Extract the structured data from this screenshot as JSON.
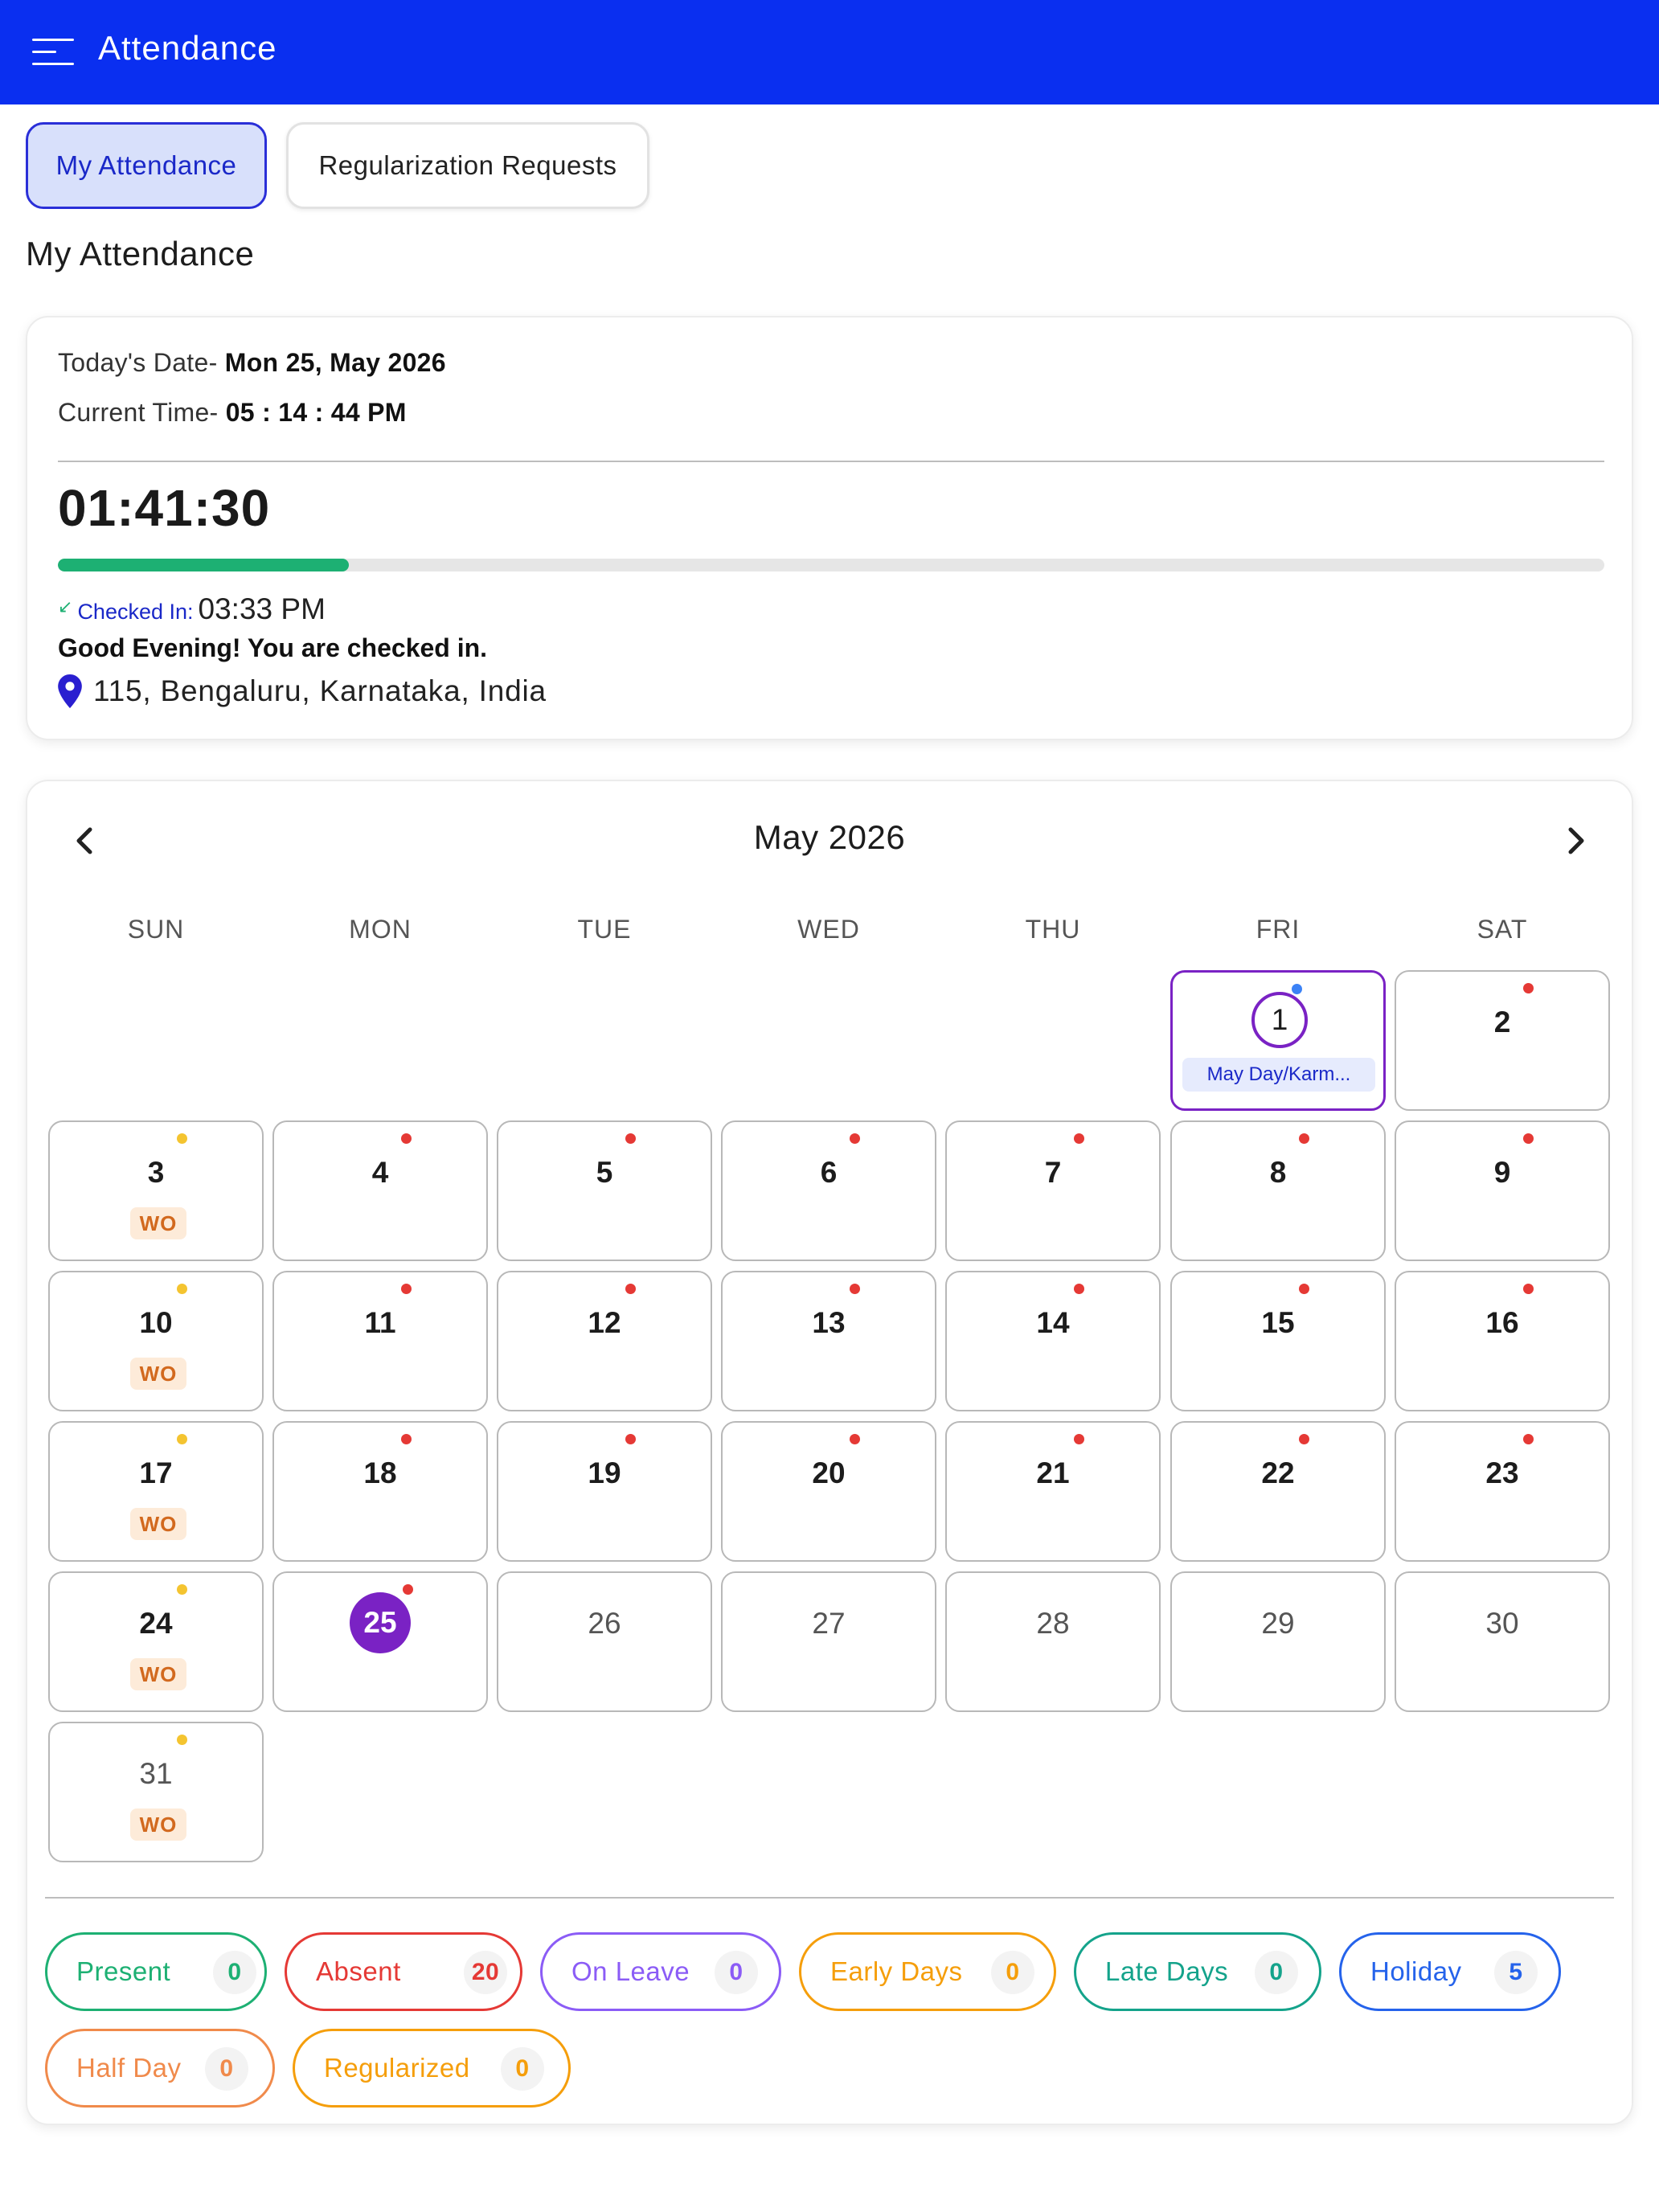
{
  "app": {
    "title": "Attendance"
  },
  "tabs": [
    {
      "label": "My Attendance"
    },
    {
      "label": "Regularization Requests"
    }
  ],
  "section_title": "My Attendance",
  "status": {
    "date_label": "Today's Date- ",
    "date_value": "Mon 25, May 2026",
    "time_label": "Current Time- ",
    "time_value": "05 : 14 : 44 PM",
    "timer": "01:41:30",
    "progress_fraction": 0.188,
    "checked_in_label": "Checked In:",
    "checked_in_time": "03:33 PM",
    "greeting": "Good Evening! You are checked in.",
    "location": "115, Bengaluru, Karnataka, India",
    "accent_green": "#1db073",
    "accent_blue": "#1a28c8"
  },
  "calendar": {
    "month_title": "May 2026",
    "weekdays": [
      "SUN",
      "MON",
      "TUE",
      "WED",
      "THU",
      "FRI",
      "SAT"
    ],
    "days": [
      {
        "day": "1",
        "dot": "blue",
        "ring": true,
        "badge": "May Day/Karm..."
      },
      {
        "day": "2",
        "dot": "red"
      },
      {
        "day": "3",
        "dot": "yellow",
        "badge": "WO"
      },
      {
        "day": "4",
        "dot": "red"
      },
      {
        "day": "5",
        "dot": "red"
      },
      {
        "day": "6",
        "dot": "red"
      },
      {
        "day": "7",
        "dot": "red"
      },
      {
        "day": "8",
        "dot": "red"
      },
      {
        "day": "9",
        "dot": "red"
      },
      {
        "day": "10",
        "dot": "yellow",
        "badge": "WO"
      },
      {
        "day": "11",
        "dot": "red"
      },
      {
        "day": "12",
        "dot": "red"
      },
      {
        "day": "13",
        "dot": "red"
      },
      {
        "day": "14",
        "dot": "red"
      },
      {
        "day": "15",
        "dot": "red"
      },
      {
        "day": "16",
        "dot": "red"
      },
      {
        "day": "17",
        "dot": "yellow",
        "badge": "WO"
      },
      {
        "day": "18",
        "dot": "red"
      },
      {
        "day": "19",
        "dot": "red"
      },
      {
        "day": "20",
        "dot": "red"
      },
      {
        "day": "21",
        "dot": "red"
      },
      {
        "day": "22",
        "dot": "red"
      },
      {
        "day": "23",
        "dot": "red"
      },
      {
        "day": "24",
        "dot": "yellow",
        "badge": "WO"
      },
      {
        "day": "25",
        "dot": "red",
        "today": true
      },
      {
        "day": "26",
        "future": true
      },
      {
        "day": "27",
        "future": true
      },
      {
        "day": "28",
        "future": true
      },
      {
        "day": "29",
        "future": true
      },
      {
        "day": "30",
        "future": true
      },
      {
        "day": "31",
        "dot": "yellow",
        "badge": "WO",
        "future": true
      }
    ],
    "first_weekday_index": 5,
    "dot_colors": {
      "red": "#e53935",
      "yellow": "#f4c430",
      "blue": "#3b82f6"
    }
  },
  "legend": [
    {
      "label": "Present",
      "count": "0",
      "color": "#1db073",
      "bg": "#ffffff"
    },
    {
      "label": "Absent",
      "count": "20",
      "color": "#e53935",
      "bg": "#ffffff"
    },
    {
      "label": "On Leave",
      "count": "0",
      "color": "#8b5cf6",
      "bg": "#ffffff"
    },
    {
      "label": "Early Days",
      "count": "0",
      "color": "#f59e0b",
      "bg": "#ffffff"
    },
    {
      "label": "Late Days",
      "count": "0",
      "color": "#14a38b",
      "bg": "#ffffff"
    },
    {
      "label": "Holiday",
      "count": "5",
      "color": "#2563eb",
      "bg": "#ffffff"
    },
    {
      "label": "Half Day",
      "count": "0",
      "color": "#f08a4b",
      "bg": "#ffffff"
    },
    {
      "label": "Regularized",
      "count": "0",
      "color": "#f59e0b",
      "bg": "#ffffff"
    }
  ]
}
